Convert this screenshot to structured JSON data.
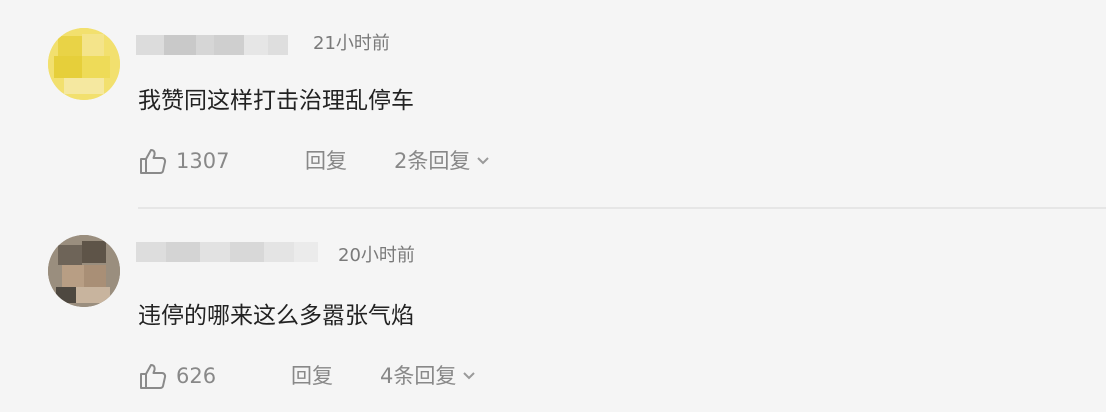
{
  "comments": [
    {
      "time": "21小时前",
      "content": "我赞同这样打击治理乱停车",
      "likes": "1307",
      "reply_label": "回复",
      "replies_label": "2条回复"
    },
    {
      "time": "20小时前",
      "content": "违停的哪来这么多嚣张气焰",
      "likes": "626",
      "reply_label": "回复",
      "replies_label": "4条回复"
    }
  ],
  "icons": {
    "like": "thumbs-up-icon",
    "expand": "chevron-down-icon"
  },
  "colors": {
    "background": "#f5f5f5",
    "text": "#222222",
    "meta": "#888888",
    "divider": "#e6e6e6"
  }
}
